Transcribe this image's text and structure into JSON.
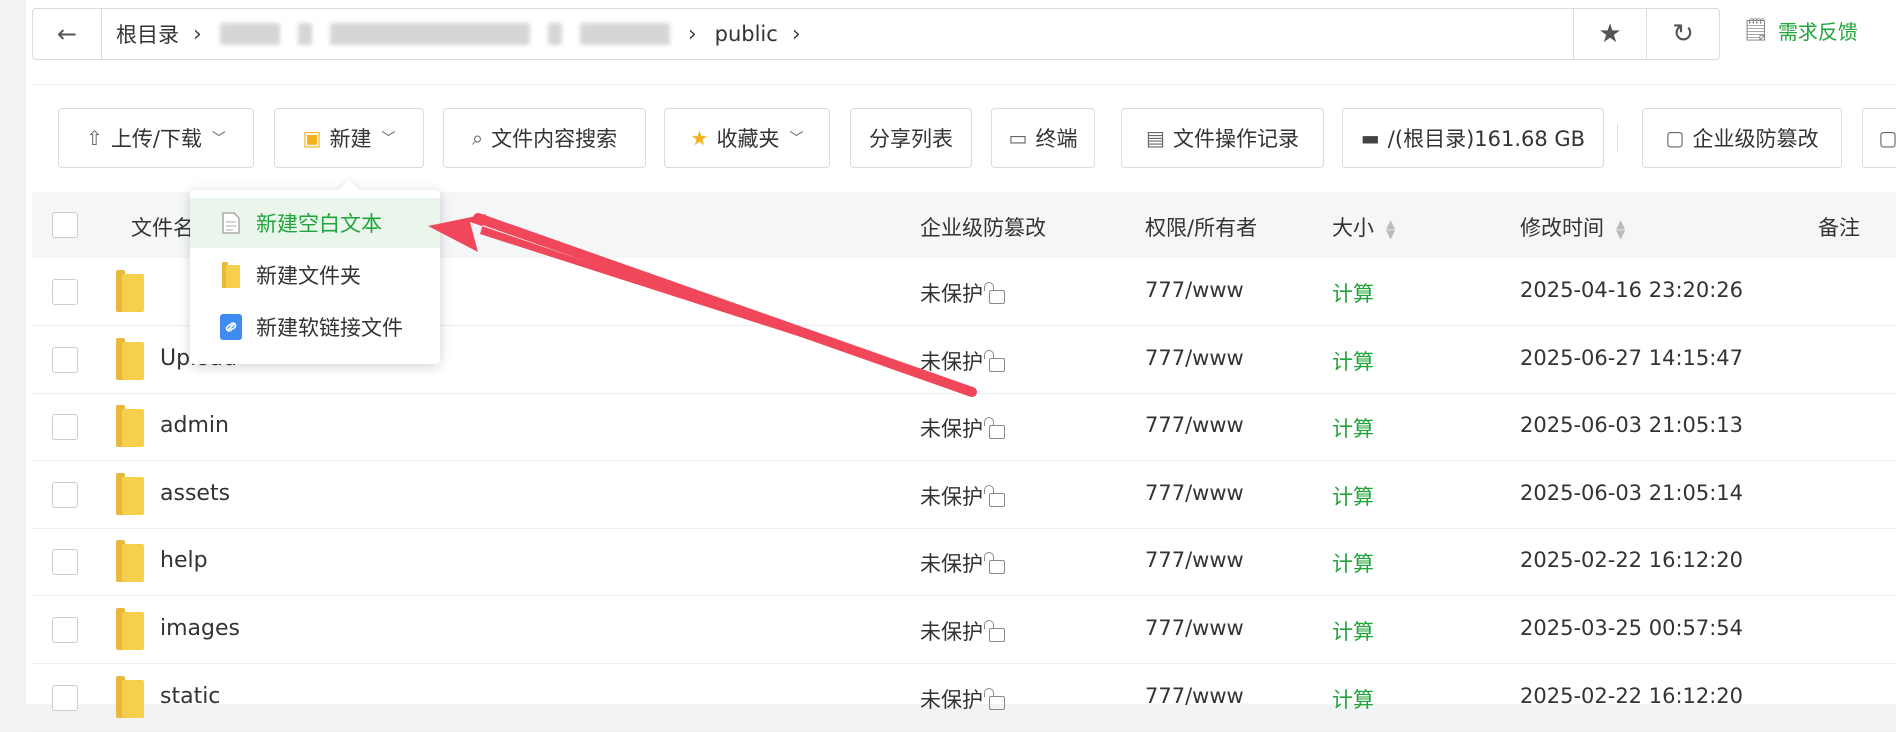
{
  "breadcrumb": {
    "back_icon": "←",
    "items": [
      "根目录",
      "public"
    ],
    "sep": "›",
    "star_icon": "★",
    "refresh_icon": "↻"
  },
  "feedback": {
    "label": "需求反馈",
    "icon": "edit-doc-icon"
  },
  "toolbar": {
    "upload_download": "上传/下载",
    "new": "新建",
    "content_search": "文件内容搜索",
    "favorites": "收藏夹",
    "share_list": "分享列表",
    "terminal": "终端",
    "op_log": "文件操作记录",
    "disk": "/(根目录)161.68 GB",
    "tamper_proof": "企业级防篡改"
  },
  "dropdown": {
    "items": [
      {
        "label": "新建空白文本",
        "icon": "text-file-icon"
      },
      {
        "label": "新建文件夹",
        "icon": "folder-icon"
      },
      {
        "label": "新建软链接文件",
        "icon": "link-file-icon"
      }
    ]
  },
  "table": {
    "headers": {
      "name": "文件名",
      "tamper": "企业级防篡改",
      "perm": "权限/所有者",
      "size": "大小",
      "mtime": "修改时间",
      "note": "备注"
    },
    "rows": [
      {
        "name": "",
        "tamper": "未保护",
        "perm": "777/www",
        "size": "计算",
        "mtime": "2025-04-16 23:20:26"
      },
      {
        "name": "Upload",
        "tamper": "未保护",
        "perm": "777/www",
        "size": "计算",
        "mtime": "2025-06-27 14:15:47"
      },
      {
        "name": "admin",
        "tamper": "未保护",
        "perm": "777/www",
        "size": "计算",
        "mtime": "2025-06-03 21:05:13"
      },
      {
        "name": "assets",
        "tamper": "未保护",
        "perm": "777/www",
        "size": "计算",
        "mtime": "2025-06-03 21:05:14"
      },
      {
        "name": "help",
        "tamper": "未保护",
        "perm": "777/www",
        "size": "计算",
        "mtime": "2025-02-22 16:12:20"
      },
      {
        "name": "images",
        "tamper": "未保护",
        "perm": "777/www",
        "size": "计算",
        "mtime": "2025-03-25 00:57:54"
      },
      {
        "name": "static",
        "tamper": "未保护",
        "perm": "777/www",
        "size": "计算",
        "mtime": "2025-02-22 16:12:20"
      }
    ]
  },
  "colors": {
    "accent": "#20a53a",
    "arrow": "#f0485a"
  }
}
